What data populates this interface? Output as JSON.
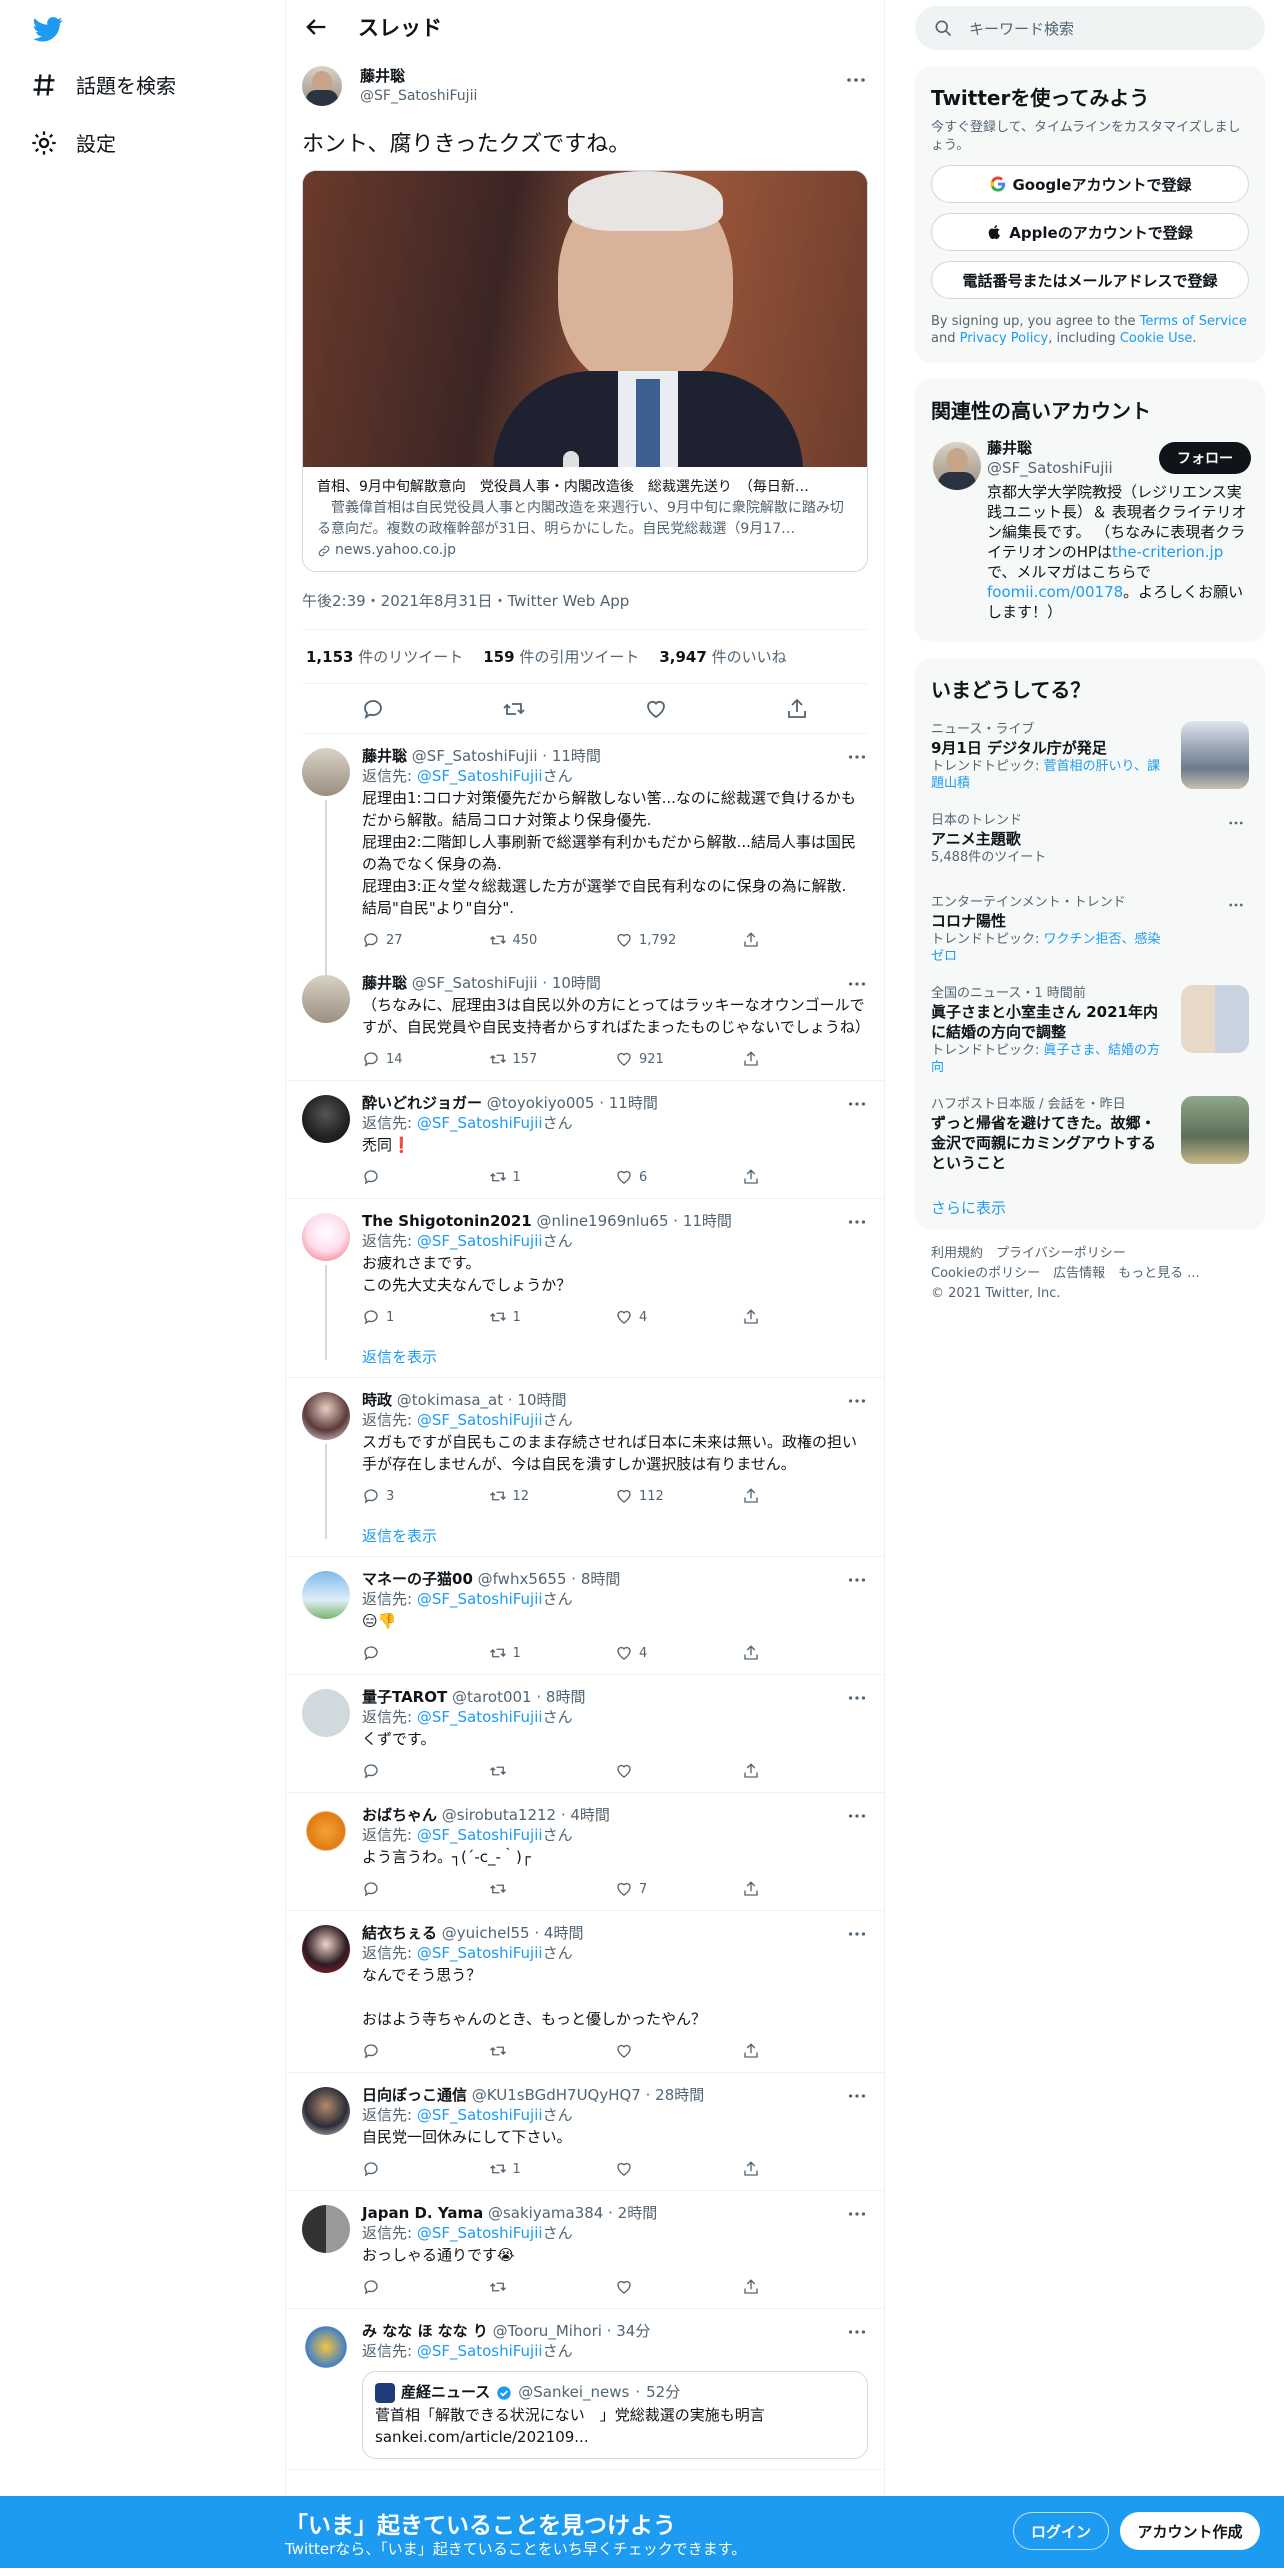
{
  "nav": {
    "explore": "話題を検索",
    "settings": "設定"
  },
  "header": {
    "title": "スレッド"
  },
  "focal": {
    "name": "藤井聡",
    "handle": "@SF_SatoshiFujii",
    "text": "ホント、腐りきったクズですね。",
    "card_title": "首相、9月中旬解散意向　党役員人事・内閣改造後　総裁選先送り　（毎日新…",
    "card_desc": "　菅義偉首相は自民党役員人事と内閣改造を来週行い、9月中旬に衆院解散に踏み切る意向だ。複数の政権幹部が31日、明らかにした。自民党総裁選（9月17…",
    "card_url": "news.yahoo.co.jp",
    "meta": "午後2:39・2021年8月31日・Twitter Web App",
    "retweets": "1,153",
    "retweets_label": "件のリツイート",
    "quotes": "159",
    "quotes_label": "件の引用ツイート",
    "likes": "3,947",
    "likes_label": "件のいいね"
  },
  "replies": [
    {
      "name": "藤井聡",
      "handle": "@SF_SatoshiFujii",
      "time": "11時間",
      "to_prefix": "返信先: ",
      "to": "@SF_SatoshiFujii",
      "to_suffix": "さん",
      "text": "屁理由1:コロナ対策優先だから解散しない筈...なのに総裁選で負けるかもだから解散。結局コロナ対策より保身優先.\n屁理由2:二階卸し人事刷新で総選挙有利かもだから解散...結局人事は国民の為でなく保身の為.\n屁理由3:正々堂々総裁選した方が選挙で自民有利なのに保身の為に解散.\n結局\"自民\"より\"自分\".",
      "reply_count": "27",
      "rt_count": "450",
      "like_count": "1,792"
    },
    {
      "name": "藤井聡",
      "handle": "@SF_SatoshiFujii",
      "time": "10時間",
      "text": "（ちなみに、屁理由3は自民以外の方にとってはラッキーなオウンゴールですが、自民党員や自民支持者からすればたまったものじゃないでしょうね）",
      "reply_count": "14",
      "rt_count": "157",
      "like_count": "921"
    },
    {
      "name": "酔いどれジョガー",
      "handle": "@toyokiyo005",
      "time": "11時間",
      "to": "@SF_SatoshiFujii",
      "text": "禿同❗",
      "reply_count": "",
      "rt_count": "1",
      "like_count": "6"
    },
    {
      "name": "The Shigotonin2021",
      "handle": "@nline1969nlu65",
      "time": "11時間",
      "to": "@SF_SatoshiFujii",
      "text": "お疲れさまです。\nこの先大丈夫なんでしょうか？",
      "reply_count": "1",
      "rt_count": "1",
      "like_count": "4",
      "show_replies": "返信を表示"
    },
    {
      "name": "時政",
      "handle": "@tokimasa_at",
      "time": "10時間",
      "to": "@SF_SatoshiFujii",
      "text": "スガもですが自民もこのまま存続させれば日本に未来は無い。政権の担い手が存在しませんが、今は自民を潰すしか選択肢は有りません。",
      "reply_count": "3",
      "rt_count": "12",
      "like_count": "112",
      "show_replies": "返信を表示"
    },
    {
      "name": "マネーの子猫00",
      "handle": "@fwhx5655",
      "time": "8時間",
      "to": "@SF_SatoshiFujii",
      "text": "😑👎",
      "reply_count": "",
      "rt_count": "1",
      "like_count": "4"
    },
    {
      "name": "量子TAROT",
      "handle": "@tarot001",
      "time": "8時間",
      "to": "@SF_SatoshiFujii",
      "text": "くずです。",
      "reply_count": "",
      "rt_count": "",
      "like_count": ""
    },
    {
      "name": "おばちゃん",
      "handle": "@sirobuta1212",
      "time": "4時間",
      "to": "@SF_SatoshiFujii",
      "text": "よう言うわ。┐(´-c_-｀)┌",
      "reply_count": "",
      "rt_count": "",
      "like_count": "7"
    },
    {
      "name": "結衣ちぇる",
      "handle": "@yuichel55",
      "time": "4時間",
      "to": "@SF_SatoshiFujii",
      "text": "なんでそう思う？\n\nおはよう寺ちゃんのとき、もっと優しかったやん？",
      "reply_count": "",
      "rt_count": "",
      "like_count": ""
    },
    {
      "name": "日向ぼっこ通信",
      "handle": "@KU1sBGdH7UQyHQ7",
      "time": "28時間",
      "to": "@SF_SatoshiFujii",
      "text": "自民党一回休みにして下さい。",
      "reply_count": "",
      "rt_count": "1",
      "like_count": ""
    },
    {
      "name": "Japan D. Yama",
      "handle": "@sakiyama384",
      "time": "2時間",
      "to": "@SF_SatoshiFujii",
      "text": "おっしゃる通りです😭",
      "reply_count": "",
      "rt_count": "",
      "like_count": ""
    },
    {
      "name": "み なな ほ なな り",
      "handle": "@Tooru_Mihori",
      "time": "34分",
      "to": "@SF_SatoshiFujii",
      "quote_name": "産経ニュース",
      "quote_handle": "@Sankei_news",
      "quote_time": "52分",
      "quote_text": "菅首相「解散できる状況にない　」党総裁選の実施も明言\nsankei.com/article/202109..."
    }
  ],
  "right": {
    "search_placeholder": "キーワード検索",
    "signup_title": "Twitterを使ってみよう",
    "signup_sub": "今すぐ登録して、タイムラインをカスタマイズしましょう。",
    "google": "Googleアカウントで登録",
    "apple": "Appleのアカウントで登録",
    "phone": "電話番号またはメールアドレスで登録",
    "terms_a": "By signing up, you agree to the ",
    "terms_b": "Terms of Service",
    "terms_c": " and ",
    "terms_d": "Privacy Policy",
    "terms_e": ", including ",
    "terms_f": "Cookie Use",
    "terms_g": ".",
    "relevant_title": "関連性の高いアカウント",
    "acct_name": "藤井聡",
    "acct_handle": "@SF_SatoshiFujii",
    "follow": "フォロー",
    "acct_bio_a": "京都大学大学院教授（レジリエンス実践ユニット長）＆ 表現者クライテリオン編集長です。 （ちなみに表現者クライテリオンのHPは",
    "acct_bio_link1": "the-criterion.jp",
    "acct_bio_b": "で、メルマガはこちらで",
    "acct_bio_link2": "foomii.com/00178",
    "acct_bio_c": "。よろしくお願いします！）",
    "trends_title": "いまどうしてる？",
    "trends": [
      {
        "cat": "ニュース・ライブ",
        "title": "9月1日 デジタル庁が発足",
        "topic_label": "トレンドトピック: ",
        "topic": "菅首相の肝いり、課題山積"
      },
      {
        "cat": "日本のトレンド",
        "title": "アニメ主題歌",
        "count": "5,488件のツイート"
      },
      {
        "cat": "エンターテインメント・トレンド",
        "title": "コロナ陽性",
        "topic_label": "トレンドトピック: ",
        "topic": "ワクチン拒否、感染ゼロ"
      },
      {
        "cat": "全国のニュース・1 時間前",
        "title": "眞子さまと小室圭さん 2021年内に結婚の方向で調整",
        "topic_label": "トレンドトピック: ",
        "topic": "眞子さま、結婚の方向"
      },
      {
        "cat": "ハフポスト日本版 / 会話を・昨日",
        "title": "ずっと帰省を避けてきた。故郷・金沢で両親にカミングアウトするということ"
      }
    ],
    "show_more": "さらに表示",
    "footer_1": "利用規約　プライバシーポリシー",
    "footer_2": "Cookieのポリシー　広告情報　もっと見る ...",
    "footer_3": "© 2021 Twitter, Inc."
  },
  "banner": {
    "title": "「いま」起きていることを見つけよう",
    "sub": "Twitterなら、「いま」起きていることをいち早くチェックできます。",
    "login": "ログイン",
    "signup": "アカウント作成"
  },
  "colors": {
    "accent": "#1d9bf0",
    "text": "#0f1419",
    "muted": "#536471"
  }
}
